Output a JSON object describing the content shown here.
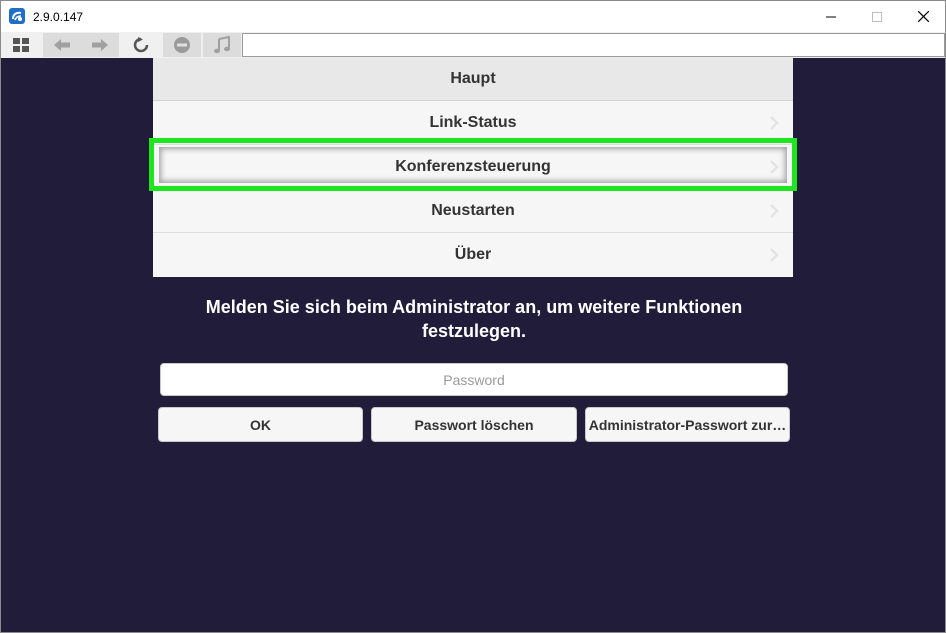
{
  "window": {
    "title": "2.9.0.147",
    "app_icon": "app-logo-icon",
    "controls": [
      "minimize-icon",
      "maximize-icon",
      "close-icon"
    ]
  },
  "toolbar": {
    "buttons": [
      {
        "name": "grid-icon"
      },
      {
        "name": "back-arrow-icon"
      },
      {
        "name": "forward-arrow-icon"
      },
      {
        "name": "reload-icon"
      },
      {
        "name": "stop-icon"
      },
      {
        "name": "music-note-icon"
      }
    ],
    "address_value": ""
  },
  "menu": {
    "header": "Haupt",
    "items": [
      {
        "label": "Link-Status"
      },
      {
        "label": "Konferenzsteuerung",
        "highlighted": true
      },
      {
        "label": "Neustarten"
      },
      {
        "label": "Über"
      }
    ]
  },
  "login": {
    "message": "Melden Sie sich beim Administrator an, um weitere Funktionen festzulegen.",
    "password_placeholder": "Password",
    "password_value": "",
    "buttons": {
      "ok": "OK",
      "clear": "Passwort löschen",
      "reset": "Administrator-Passwort zur…"
    }
  },
  "colors": {
    "background": "#221c3b",
    "highlight": "#1ee61e",
    "menu_bg": "#f6f6f6"
  }
}
